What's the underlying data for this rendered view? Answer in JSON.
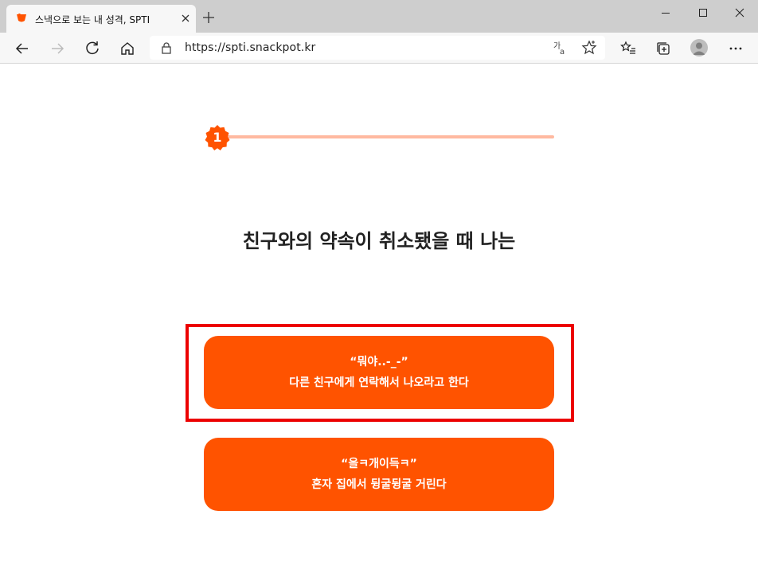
{
  "browser": {
    "tab_title": "스낵으로 보는 내 성격, SPTI",
    "url": "https://spti.snackpot.kr"
  },
  "quiz": {
    "step": "1",
    "question": "친구와의 약속이 취소됐을 때 나는",
    "answers": [
      {
        "line1": "“뭐야..-_-”",
        "line2": "다른 친구에게 연락해서 나오라고 한다"
      },
      {
        "line1": "“올ㅋ개이득ㅋ”",
        "line2": "혼자 집에서 뒹굴뒹굴 거린다"
      }
    ]
  },
  "colors": {
    "accent": "#ff5300",
    "progress_track": "#ffb9a0",
    "highlight": "#ec0000"
  }
}
